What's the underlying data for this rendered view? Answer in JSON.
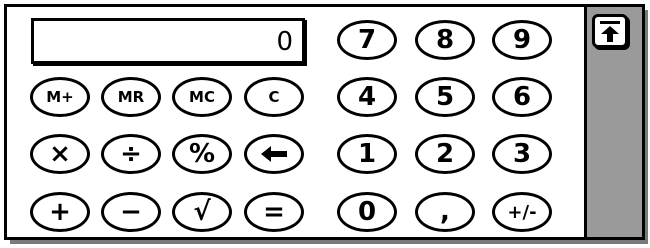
{
  "display": {
    "value": "0"
  },
  "memory_keys": [
    {
      "label": "M+"
    },
    {
      "label": "MR"
    },
    {
      "label": "MC"
    },
    {
      "label": "C"
    }
  ],
  "op_row": [
    {
      "label": "×"
    },
    {
      "label": "÷"
    },
    {
      "label": "%"
    },
    {
      "label": "backspace"
    }
  ],
  "bottom_ops": [
    {
      "label": "+"
    },
    {
      "label": "−"
    },
    {
      "label": "√"
    },
    {
      "label": "="
    }
  ],
  "number_pad": [
    [
      "7",
      "8",
      "9"
    ],
    [
      "4",
      "5",
      "6"
    ],
    [
      "1",
      "2",
      "3"
    ],
    [
      "0",
      ",",
      "+/-"
    ]
  ],
  "panel": {
    "up_button_icon": "arrow-up-to-line-icon"
  }
}
